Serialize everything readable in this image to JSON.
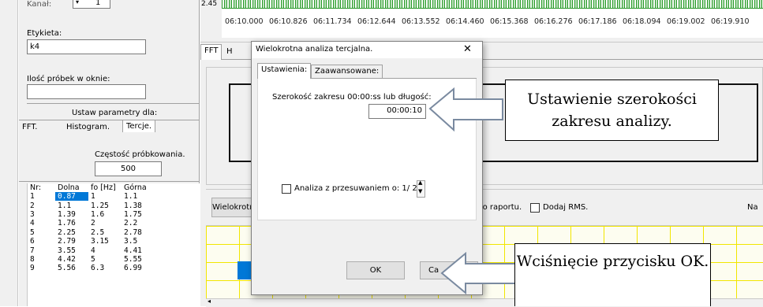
{
  "left": {
    "kanal_label": "Kanał:",
    "kanal_value": "1",
    "etykieta_label": "Etykieta:",
    "etykieta_value": "k4",
    "probki_label": "Ilość próbek w oknie:",
    "probki_value": "",
    "ustaw_label": "Ustaw parametry dla:",
    "tabs": [
      "FFT.",
      "Histogram.",
      "Tercje."
    ],
    "czestosc_label": "Częstość próbkowania.",
    "czestosc_value": "500",
    "table_headers": [
      "Nr:",
      "Dolna",
      "fo [Hz]",
      "Górna"
    ],
    "table_rows": [
      [
        "1",
        "0.87",
        "1",
        "1.1"
      ],
      [
        "2",
        "1.1",
        "1.25",
        "1.38"
      ],
      [
        "3",
        "1.39",
        "1.6",
        "1.75"
      ],
      [
        "4",
        "1.76",
        "2",
        "2.2"
      ],
      [
        "5",
        "2.25",
        "2.5",
        "2.78"
      ],
      [
        "6",
        "2.79",
        "3.15",
        "3.5"
      ],
      [
        "7",
        "3.55",
        "4",
        "4.41"
      ],
      [
        "8",
        "4.42",
        "5",
        "5.55"
      ],
      [
        "9",
        "5.56",
        "6.3",
        "6.99"
      ]
    ]
  },
  "timeline": {
    "y_value": "2.45",
    "ticks": [
      "06:10.000",
      "06:10.826",
      "06:11.734",
      "06:12.644",
      "06:13.552",
      "06:14.460",
      "06:15.368",
      "06:16.276",
      "06:17.186",
      "06:18.094",
      "06:19.002",
      "06:19.910"
    ]
  },
  "right": {
    "tabs": [
      "FFT",
      "H"
    ],
    "wielokrotna_btn": "Wielokrotna",
    "dodaj_raport": "Dodaj do raportu.",
    "dodaj_raport_checked": true,
    "dodaj_rms": "Dodaj RMS.",
    "dodaj_rms_checked": false,
    "na_label": "Na"
  },
  "dialog": {
    "title": "Wielokrotna analiza tercjalna.",
    "close": "✕",
    "tabs": [
      "Ustawienia:",
      "Zaawansowane:"
    ],
    "szerokosc_label": "Szerokość zakresu 00:00:ss lub długość:",
    "szerokosc_value": "00:00:10",
    "przesuw_label": "Analiza z przesuwaniem o: 1/ 2",
    "przesuw_checked": false,
    "ok_label": "OK",
    "cancel_label": "Ca"
  },
  "callouts": {
    "top": "Ustawienie szerokości zakresu analizy.",
    "bottom": "Wciśnięcie przycisku OK."
  },
  "colors": {
    "selection": "#0078d7",
    "grid_yellow": "#f2e600",
    "wave_green": "#2a9a2a"
  }
}
